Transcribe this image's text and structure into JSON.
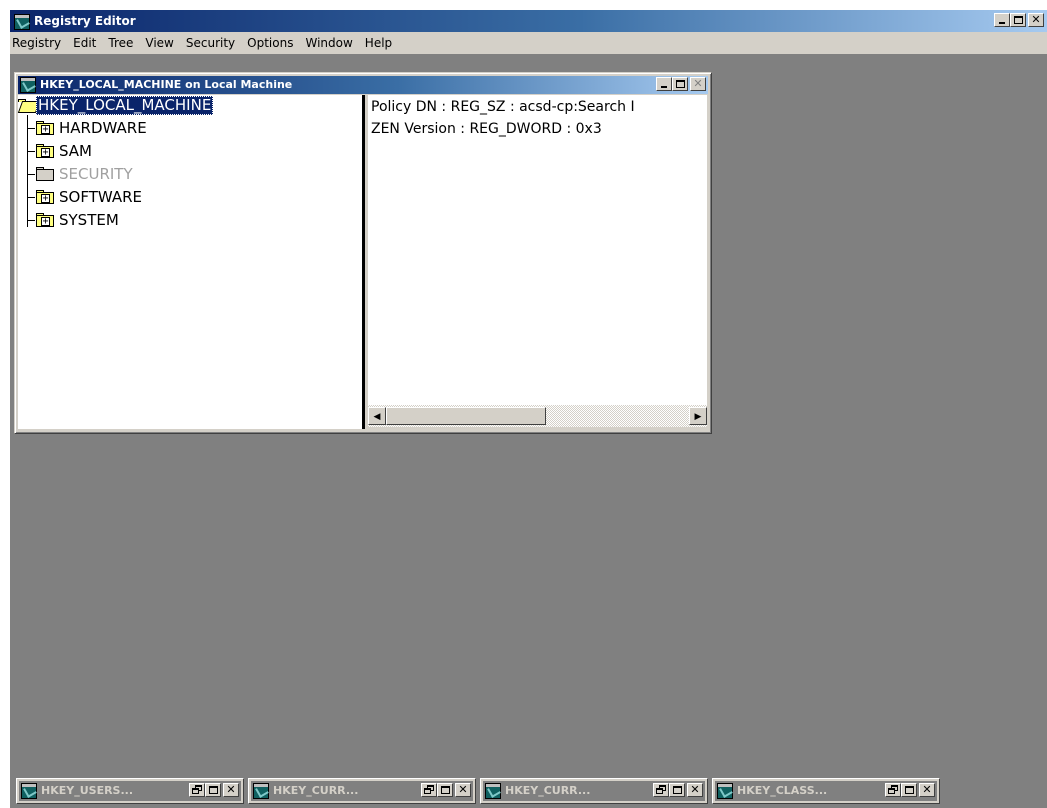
{
  "app": {
    "title": "Registry Editor",
    "menu": [
      "Registry",
      "Edit",
      "Tree",
      "View",
      "Security",
      "Options",
      "Window",
      "Help"
    ]
  },
  "child": {
    "title": "HKEY_LOCAL_MACHINE on Local Machine",
    "tree": {
      "root": "HKEY_LOCAL_MACHINE",
      "items": [
        {
          "label": "HARDWARE",
          "expandable": true
        },
        {
          "label": "SAM",
          "expandable": true
        },
        {
          "label": "SECURITY",
          "expandable": false
        },
        {
          "label": "SOFTWARE",
          "expandable": true
        },
        {
          "label": "SYSTEM",
          "expandable": true
        }
      ]
    },
    "values": [
      "Policy DN : REG_SZ : acsd-cp:Search I",
      "ZEN Version : REG_DWORD : 0x3"
    ]
  },
  "minimized": [
    {
      "title": "HKEY_USERS..."
    },
    {
      "title": "HKEY_CURR..."
    },
    {
      "title": "HKEY_CURR..."
    },
    {
      "title": "HKEY_CLASS..."
    }
  ],
  "colors": {
    "titlebar_active": "#0a246a",
    "mdi_background": "#808080",
    "selection": "#0a246a"
  }
}
